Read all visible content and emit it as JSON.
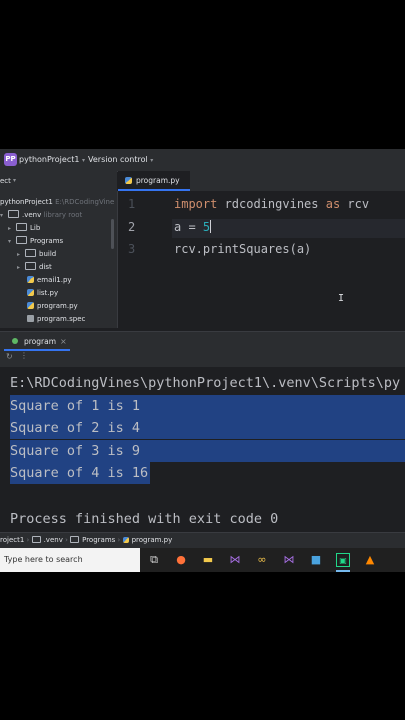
{
  "toolbar": {
    "project_badge": "PP",
    "project_name": "pythonProject1",
    "version_control": "Version control"
  },
  "project_panel": {
    "header": "ect",
    "root_name": "pythonProject1",
    "root_path": "E:\\RDCodingVine",
    "items": [
      {
        "label": ".venv",
        "hint": "library root"
      },
      {
        "label": "Lib"
      },
      {
        "label": "Programs"
      },
      {
        "label": "build"
      },
      {
        "label": "dist"
      },
      {
        "label": "email1.py"
      },
      {
        "label": "list.py"
      },
      {
        "label": "program.py"
      },
      {
        "label": "program.spec"
      }
    ]
  },
  "editor": {
    "tab_label": "program.py",
    "line_numbers": [
      "1",
      "2",
      "3"
    ],
    "line1": {
      "kw": "import",
      "rest": " rdcodingvines ",
      "kw2": "as",
      "alias": " rcv"
    },
    "line2": {
      "lhs": "a = ",
      "value": "5"
    },
    "line3": "rcv.printSquares(a)"
  },
  "run": {
    "tab_label": "program",
    "command": "E:\\RDCodingVines\\pythonProject1\\.venv\\Scripts\\py",
    "output": [
      "Square of 1 is 1",
      "Square of 2 is 4",
      "Square of 3 is 9",
      "Square of 4 is 16"
    ],
    "exit_message": "Process finished with exit code 0"
  },
  "statusbar": {
    "crumbs": [
      "roject1",
      ".venv",
      "Programs",
      "program.py"
    ]
  },
  "taskbar": {
    "search_placeholder": "Type here to search"
  },
  "colors": {
    "accent": "#3574f0",
    "selection": "#214283",
    "keyword": "#cf8e6d",
    "number": "#2aacb8"
  }
}
